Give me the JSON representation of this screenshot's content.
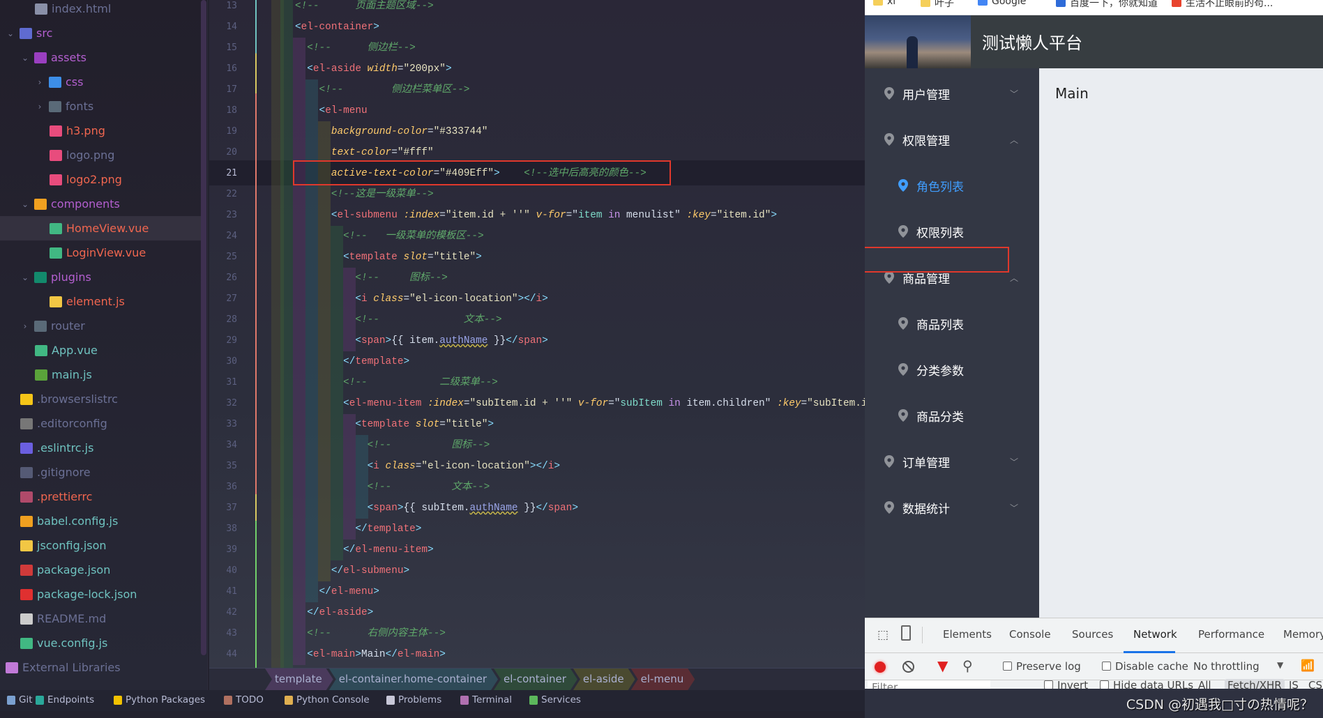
{
  "project_tree": {
    "items": [
      {
        "label": "index.html",
        "depth": 2,
        "icon": "html-file-icon",
        "color": "#6b7095",
        "iconColor": "#8a90a8"
      },
      {
        "label": "src",
        "depth": 0,
        "chevron": "down",
        "icon": "folder-src-icon",
        "color": "#b45fd0",
        "iconColor": "#5f6bd0"
      },
      {
        "label": "assets",
        "depth": 1,
        "chevron": "down",
        "icon": "folder-assets-icon",
        "color": "#b45fd0",
        "iconColor": "#9a3fc0"
      },
      {
        "label": "css",
        "depth": 2,
        "chevron": "right",
        "icon": "folder-css-icon",
        "color": "#b45fd0",
        "iconColor": "#3d8ee8"
      },
      {
        "label": "fonts",
        "depth": 2,
        "chevron": "right",
        "icon": "folder-fonts-icon",
        "color": "#6b7095",
        "iconColor": "#5a6a78"
      },
      {
        "label": "h3.png",
        "depth": 3,
        "icon": "image-file-icon",
        "color": "#f0664f",
        "iconColor": "#e84c7d"
      },
      {
        "label": "logo.png",
        "depth": 3,
        "icon": "image-file-icon",
        "color": "#6b7095",
        "iconColor": "#e84c7d"
      },
      {
        "label": "logo2.png",
        "depth": 3,
        "icon": "image-file-icon",
        "color": "#f0664f",
        "iconColor": "#e84c7d"
      },
      {
        "label": "components",
        "depth": 1,
        "chevron": "down",
        "icon": "folder-components-icon",
        "color": "#b45fd0",
        "iconColor": "#f0a020"
      },
      {
        "label": "HomeView.vue",
        "depth": 3,
        "icon": "vue-file-icon",
        "color": "#f0664f",
        "iconColor": "#41b883",
        "selected": true
      },
      {
        "label": "LoginView.vue",
        "depth": 3,
        "icon": "vue-file-icon",
        "color": "#f0664f",
        "iconColor": "#41b883"
      },
      {
        "label": "plugins",
        "depth": 1,
        "chevron": "down",
        "icon": "folder-plugins-icon",
        "color": "#b45fd0",
        "iconColor": "#138a6c"
      },
      {
        "label": "element.js",
        "depth": 3,
        "icon": "js-file-icon",
        "color": "#f0664f",
        "iconColor": "#f2c744"
      },
      {
        "label": "router",
        "depth": 1,
        "chevron": "right",
        "icon": "folder-router-icon",
        "color": "#6b7095",
        "iconColor": "#5a6a78"
      },
      {
        "label": "App.vue",
        "depth": 2,
        "icon": "vue-file-icon",
        "color": "#6fc3c0",
        "iconColor": "#41b883"
      },
      {
        "label": "main.js",
        "depth": 2,
        "icon": "nodejs-file-icon",
        "color": "#6fc3c0",
        "iconColor": "#5aa33a"
      },
      {
        "label": ".browserslistrc",
        "depth": 1,
        "icon": "browserslist-icon",
        "color": "#6b7095",
        "iconColor": "#f5c518"
      },
      {
        "label": ".editorconfig",
        "depth": 1,
        "icon": "editorconfig-icon",
        "color": "#6b7095",
        "iconColor": "#777"
      },
      {
        "label": ".eslintrc.js",
        "depth": 1,
        "icon": "eslint-icon",
        "color": "#6fc3c0",
        "iconColor": "#6b5fe0"
      },
      {
        "label": ".gitignore",
        "depth": 1,
        "icon": "git-icon",
        "color": "#6b7095",
        "iconColor": "#555a75"
      },
      {
        "label": ".prettierrc",
        "depth": 1,
        "icon": "prettier-icon",
        "color": "#f0664f",
        "iconColor": "#b04a6a"
      },
      {
        "label": "babel.config.js",
        "depth": 1,
        "icon": "babel-icon",
        "color": "#6fc3c0",
        "iconColor": "#f0a020"
      },
      {
        "label": "jsconfig.json",
        "depth": 1,
        "icon": "jsconfig-icon",
        "color": "#6fc3c0",
        "iconColor": "#f2c744"
      },
      {
        "label": "package.json",
        "depth": 1,
        "icon": "npm-icon",
        "color": "#6fc3c0",
        "iconColor": "#d03a3a"
      },
      {
        "label": "package-lock.json",
        "depth": 1,
        "icon": "lock-icon",
        "color": "#6fc3c0",
        "iconColor": "#e03030"
      },
      {
        "label": "README.md",
        "depth": 1,
        "icon": "readme-icon",
        "color": "#6b7095",
        "iconColor": "#ccc"
      },
      {
        "label": "vue.config.js",
        "depth": 1,
        "icon": "vue-file-icon",
        "color": "#6fc3c0",
        "iconColor": "#41b883"
      },
      {
        "label": "External Libraries",
        "depth": 0,
        "icon": "library-icon",
        "color": "#6b7095",
        "iconColor": "#c17ad8"
      }
    ]
  },
  "editor": {
    "first_line_number": 13,
    "current_line": 21,
    "lines": [
      [
        [
          "c",
          "<!--      页面主题区域-->"
        ]
      ],
      [
        [
          "p",
          "<"
        ],
        [
          "t",
          "el-container"
        ],
        [
          "p",
          ">"
        ]
      ],
      [
        [
          "x",
          "  "
        ],
        [
          "c",
          "<!--      侧边栏-->"
        ]
      ],
      [
        [
          "x",
          "  "
        ],
        [
          "p",
          "<"
        ],
        [
          "t",
          "el-aside"
        ],
        [
          "a",
          " width"
        ],
        [
          "x",
          "="
        ],
        [
          "s",
          "\"200px\""
        ],
        [
          "p",
          ">"
        ]
      ],
      [
        [
          "x",
          "    "
        ],
        [
          "c",
          "<!--        侧边栏菜单区-->"
        ]
      ],
      [
        [
          "x",
          "    "
        ],
        [
          "p",
          "<"
        ],
        [
          "t",
          "el-menu"
        ]
      ],
      [
        [
          "x",
          "      "
        ],
        [
          "a",
          "background-color"
        ],
        [
          "x",
          "="
        ],
        [
          "s",
          "\"#333744\""
        ]
      ],
      [
        [
          "x",
          "      "
        ],
        [
          "a",
          "text-color"
        ],
        [
          "x",
          "="
        ],
        [
          "s",
          "\"#fff\""
        ]
      ],
      [
        [
          "x",
          "      "
        ],
        [
          "a",
          "active-text-color"
        ],
        [
          "x",
          "="
        ],
        [
          "s",
          "\"#409Eff\""
        ],
        [
          "p",
          ">"
        ],
        [
          "c",
          "    <!--选中后高亮的颜色-->"
        ]
      ],
      [
        [
          "x",
          "      "
        ],
        [
          "c",
          "<!--这是一级菜单-->"
        ]
      ],
      [
        [
          "x",
          "      "
        ],
        [
          "p",
          "<"
        ],
        [
          "t",
          "el-submenu"
        ],
        [
          "a",
          " :index"
        ],
        [
          "x",
          "="
        ],
        [
          "s",
          "\"item.id + ''\""
        ],
        [
          "a",
          " v-for"
        ],
        [
          "x",
          "=\""
        ],
        [
          "v",
          "item"
        ],
        [
          "x",
          " "
        ],
        [
          "k",
          "in"
        ],
        [
          "x",
          " menulist\""
        ],
        [
          "a",
          " :key"
        ],
        [
          "x",
          "="
        ],
        [
          "s",
          "\"item.id\""
        ],
        [
          "p",
          ">"
        ]
      ],
      [
        [
          "x",
          "        "
        ],
        [
          "c",
          "<!--   一级菜单的模板区-->"
        ]
      ],
      [
        [
          "x",
          "        "
        ],
        [
          "p",
          "<"
        ],
        [
          "t",
          "template"
        ],
        [
          "a",
          " slot"
        ],
        [
          "x",
          "="
        ],
        [
          "s",
          "\"title\""
        ],
        [
          "p",
          ">"
        ]
      ],
      [
        [
          "x",
          "          "
        ],
        [
          "c",
          "<!--     图标-->"
        ]
      ],
      [
        [
          "x",
          "          "
        ],
        [
          "p",
          "<"
        ],
        [
          "t",
          "i"
        ],
        [
          "a",
          " class"
        ],
        [
          "x",
          "="
        ],
        [
          "s",
          "\"el-icon-location\""
        ],
        [
          "p",
          "></"
        ],
        [
          "t",
          "i"
        ],
        [
          "p",
          ">"
        ]
      ],
      [
        [
          "x",
          "          "
        ],
        [
          "c",
          "<!--              文本-->"
        ]
      ],
      [
        [
          "x",
          "          "
        ],
        [
          "p",
          "<"
        ],
        [
          "t",
          "span"
        ],
        [
          "p",
          ">"
        ],
        [
          "x",
          "{{ item."
        ],
        [
          "u",
          "authName"
        ],
        [
          "x",
          " }}"
        ],
        [
          "p",
          "</"
        ],
        [
          "t",
          "span"
        ],
        [
          "p",
          ">"
        ]
      ],
      [
        [
          "x",
          "        "
        ],
        [
          "p",
          "</"
        ],
        [
          "t",
          "template"
        ],
        [
          "p",
          ">"
        ]
      ],
      [
        [
          "x",
          "        "
        ],
        [
          "c",
          "<!--            二级菜单-->"
        ]
      ],
      [
        [
          "x",
          "        "
        ],
        [
          "p",
          "<"
        ],
        [
          "t",
          "el-menu-item"
        ],
        [
          "a",
          " :index"
        ],
        [
          "x",
          "="
        ],
        [
          "s",
          "\"subItem.id + ''\""
        ],
        [
          "a",
          " v-for"
        ],
        [
          "x",
          "=\""
        ],
        [
          "v",
          "subItem"
        ],
        [
          "x",
          " "
        ],
        [
          "k",
          "in"
        ],
        [
          "x",
          " item.children\""
        ],
        [
          "a",
          " :key"
        ],
        [
          "x",
          "="
        ],
        [
          "s",
          "\"subItem.id\""
        ],
        [
          "p",
          ">"
        ]
      ],
      [
        [
          "x",
          "          "
        ],
        [
          "p",
          "<"
        ],
        [
          "t",
          "template"
        ],
        [
          "a",
          " slot"
        ],
        [
          "x",
          "="
        ],
        [
          "s",
          "\"title\""
        ],
        [
          "p",
          ">"
        ]
      ],
      [
        [
          "x",
          "            "
        ],
        [
          "c",
          "<!--          图标-->"
        ]
      ],
      [
        [
          "x",
          "            "
        ],
        [
          "p",
          "<"
        ],
        [
          "t",
          "i"
        ],
        [
          "a",
          " class"
        ],
        [
          "x",
          "="
        ],
        [
          "s",
          "\"el-icon-location\""
        ],
        [
          "p",
          "></"
        ],
        [
          "t",
          "i"
        ],
        [
          "p",
          ">"
        ]
      ],
      [
        [
          "x",
          "            "
        ],
        [
          "c",
          "<!--          文本-->"
        ]
      ],
      [
        [
          "x",
          "            "
        ],
        [
          "p",
          "<"
        ],
        [
          "t",
          "span"
        ],
        [
          "p",
          ">"
        ],
        [
          "x",
          "{{ subItem."
        ],
        [
          "u",
          "authName"
        ],
        [
          "x",
          " }}"
        ],
        [
          "p",
          "</"
        ],
        [
          "t",
          "span"
        ],
        [
          "p",
          ">"
        ]
      ],
      [
        [
          "x",
          "          "
        ],
        [
          "p",
          "</"
        ],
        [
          "t",
          "template"
        ],
        [
          "p",
          ">"
        ]
      ],
      [
        [
          "x",
          "        "
        ],
        [
          "p",
          "</"
        ],
        [
          "t",
          "el-menu-item"
        ],
        [
          "p",
          ">"
        ]
      ],
      [
        [
          "x",
          "      "
        ],
        [
          "p",
          "</"
        ],
        [
          "t",
          "el-submenu"
        ],
        [
          "p",
          ">"
        ]
      ],
      [
        [
          "x",
          "    "
        ],
        [
          "p",
          "</"
        ],
        [
          "t",
          "el-menu"
        ],
        [
          "p",
          ">"
        ]
      ],
      [
        [
          "x",
          "  "
        ],
        [
          "p",
          "</"
        ],
        [
          "t",
          "el-aside"
        ],
        [
          "p",
          ">"
        ]
      ],
      [
        [
          "x",
          "  "
        ],
        [
          "c",
          "<!--      右侧内容主体-->"
        ]
      ],
      [
        [
          "x",
          "  "
        ],
        [
          "p",
          "<"
        ],
        [
          "t",
          "el-main"
        ],
        [
          "p",
          ">"
        ],
        [
          "x",
          "Main"
        ],
        [
          "p",
          "</"
        ],
        [
          "t",
          "el-main"
        ],
        [
          "p",
          ">"
        ]
      ]
    ],
    "breadcrumbs": [
      {
        "label": "template",
        "color": "#4a3a5c"
      },
      {
        "label": "el-container.home-container",
        "color": "#2f4a58"
      },
      {
        "label": "el-container",
        "color": "#2f4a3a"
      },
      {
        "label": "el-aside",
        "color": "#4a4a30"
      },
      {
        "label": "el-menu",
        "color": "#5a2d34"
      }
    ]
  },
  "bottom_toolbar": [
    {
      "label": "Git",
      "icon": "git-icon",
      "color": "#7aa0d0"
    },
    {
      "label": "Endpoints",
      "icon": "endpoints-icon",
      "color": "#2aa89a"
    },
    {
      "label": "Python Packages",
      "icon": "python-packages-icon",
      "color": "#f2c200"
    },
    {
      "label": "TODO",
      "icon": "todo-icon",
      "color": "#b07060"
    },
    {
      "label": "Python Console",
      "icon": "python-console-icon",
      "color": "#e0b050"
    },
    {
      "label": "Problems",
      "icon": "problems-icon",
      "color": "#c8c8d8"
    },
    {
      "label": "Terminal",
      "icon": "terminal-icon",
      "color": "#b070b0"
    },
    {
      "label": "Services",
      "icon": "services-icon",
      "color": "#5cb85c"
    }
  ],
  "browser": {
    "bookmarks": [
      "xl",
      "叶子",
      "Google",
      "百度一下，你就知道",
      "生活不止眼前的苟..."
    ],
    "app_title": "测试懒人平台",
    "main_text": "Main",
    "active_color": "#409EFF",
    "menu": [
      {
        "label": "用户管理",
        "level": 1,
        "arrow": "down"
      },
      {
        "label": "权限管理",
        "level": 1,
        "arrow": "up"
      },
      {
        "label": "角色列表",
        "level": 2,
        "active": true
      },
      {
        "label": "权限列表",
        "level": 2
      },
      {
        "label": "商品管理",
        "level": 1,
        "arrow": "up"
      },
      {
        "label": "商品列表",
        "level": 2
      },
      {
        "label": "分类参数",
        "level": 2
      },
      {
        "label": "商品分类",
        "level": 2
      },
      {
        "label": "订单管理",
        "level": 1,
        "arrow": "down"
      },
      {
        "label": "数据统计",
        "level": 1,
        "arrow": "down"
      }
    ]
  },
  "devtools": {
    "tabs": [
      "Elements",
      "Console",
      "Sources",
      "Network",
      "Performance",
      "Memory"
    ],
    "active_tab": "Network",
    "preserve_log": "Preserve log",
    "disable_cache": "Disable cache",
    "throttling": "No throttling",
    "filter_placeholder": "Filter",
    "invert": "Invert",
    "hide_data_urls": "Hide data URLs",
    "types": [
      "All",
      "Fetch/XHR",
      "JS",
      "CSS"
    ],
    "selected_type": "Fetch/XHR"
  },
  "watermark": "CSDN @初遇我□寸の热情呢？"
}
